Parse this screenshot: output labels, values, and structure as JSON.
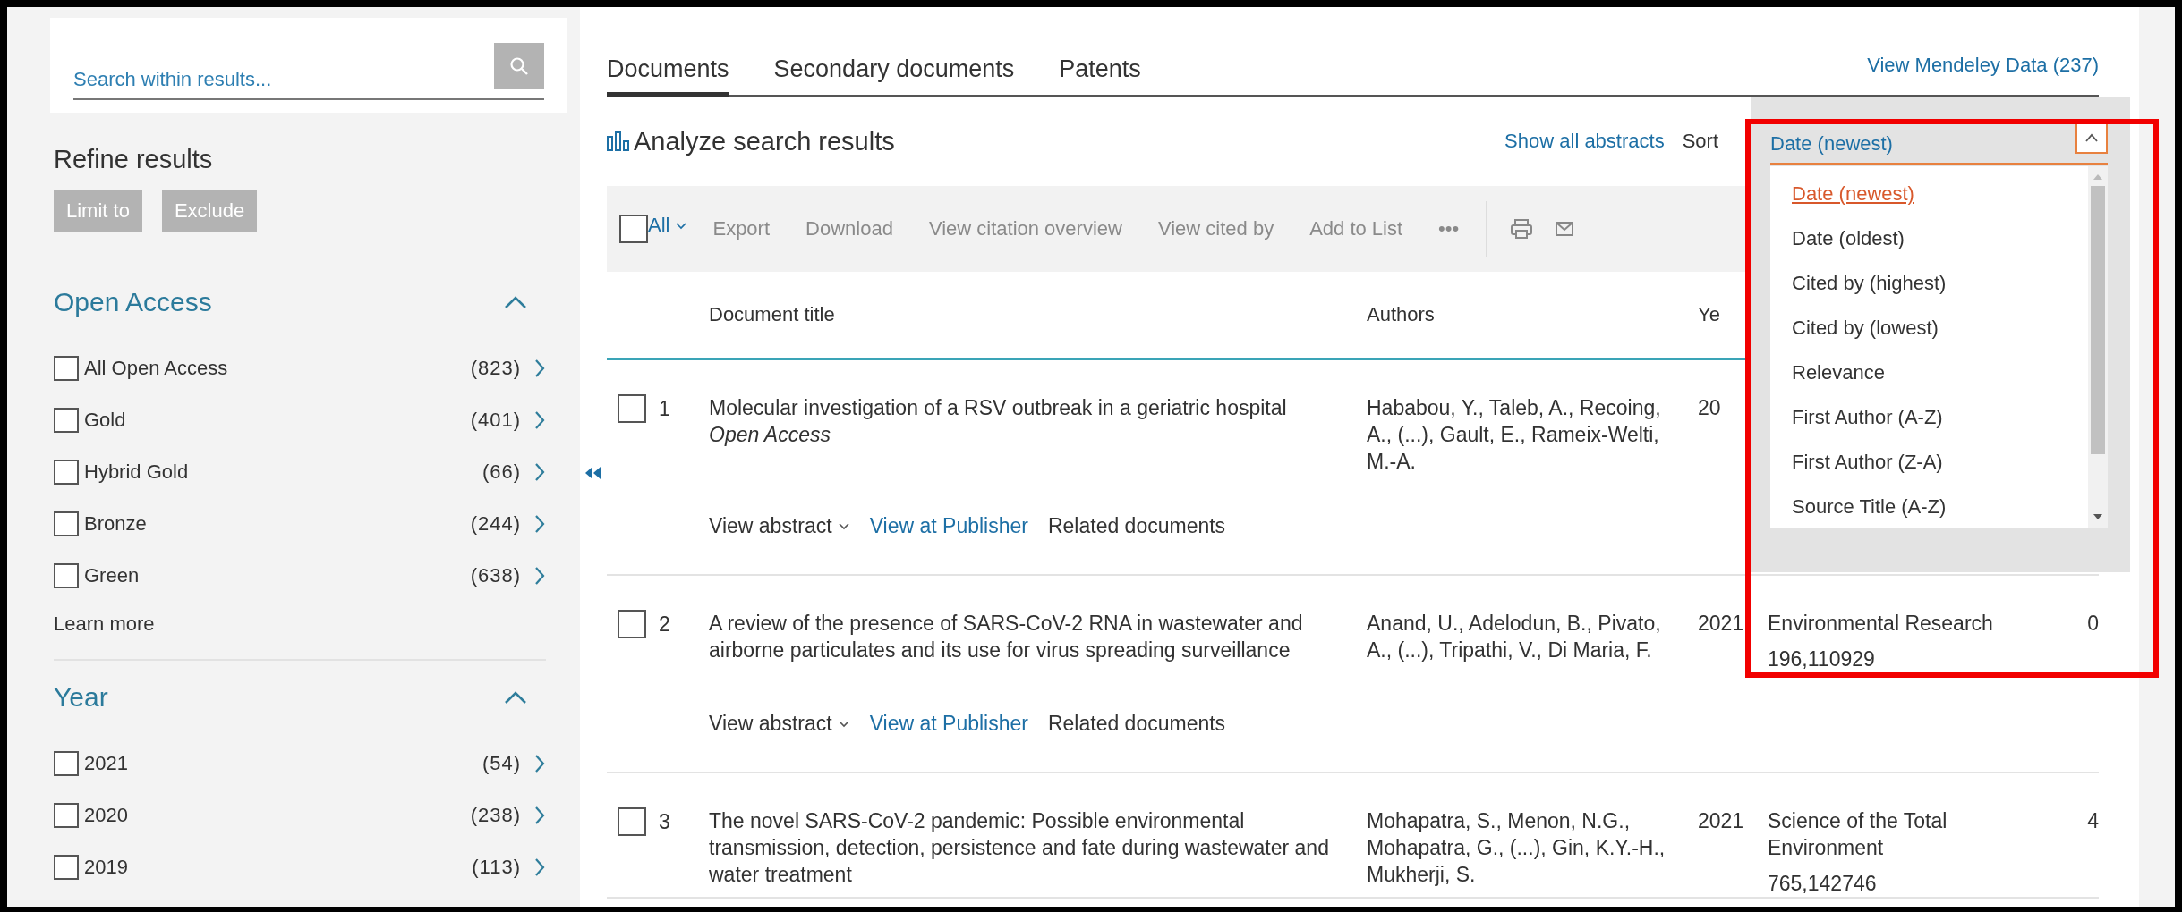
{
  "sidebar": {
    "search": {
      "placeholder": "Search within results..."
    },
    "title": "Refine results",
    "buttons": [
      "Limit to",
      "Exclude"
    ],
    "facets": [
      {
        "title": "Open Access",
        "expanded": true,
        "items": [
          {
            "label": "All Open Access",
            "count": "(823)",
            "checked": false
          },
          {
            "label": "Gold",
            "count": "(401)",
            "checked": false
          },
          {
            "label": "Hybrid Gold",
            "count": "(66)",
            "checked": false
          },
          {
            "label": "Bronze",
            "count": "(244)",
            "checked": false
          },
          {
            "label": "Green",
            "count": "(638)",
            "checked": false
          }
        ],
        "footer_link": "Learn more"
      },
      {
        "title": "Year",
        "expanded": true,
        "items": [
          {
            "label": "2021",
            "count": "(54)",
            "checked": false
          },
          {
            "label": "2020",
            "count": "(238)",
            "checked": false
          },
          {
            "label": "2019",
            "count": "(113)",
            "checked": false
          }
        ]
      }
    ]
  },
  "tabs": [
    {
      "label": "Documents",
      "selected": true
    },
    {
      "label": "Secondary documents",
      "selected": false
    },
    {
      "label": "Patents",
      "selected": false
    }
  ],
  "mendeley_link": "View Mendeley Data (237)",
  "analyze": "Analyze search results",
  "show_abstracts": "Show all abstracts",
  "sort_label": "Sort",
  "toolbar": {
    "select_all": {
      "label": "All",
      "checked": false
    },
    "actions": [
      "Export",
      "Download",
      "View citation overview",
      "View cited by",
      "Add to List",
      "•••"
    ]
  },
  "table": {
    "columns": [
      "Document title",
      "Authors",
      "Ye"
    ],
    "rows": [
      {
        "checked": false,
        "number": "1",
        "title": "Molecular investigation of a RSV outbreak in a geriatric hospital",
        "access": "Open Access",
        "authors": "Hababou, Y., Taleb, A., Recoing, A., (...), Gault, E., Rameix-Welti, M.-A.",
        "year": "20",
        "actions": [
          {
            "kind": "toggle",
            "label": "View abstract"
          },
          {
            "kind": "link",
            "label": "View at Publisher"
          },
          {
            "kind": "plain",
            "label": "Related documents"
          }
        ]
      },
      {
        "checked": false,
        "number": "2",
        "title": "A review of the presence of SARS-CoV-2 RNA in wastewater and airborne particulates and its use for virus spreading surveillance",
        "authors": "Anand, U., Adelodun, B., Pivato, A., (...), Tripathi, V., Di Maria, F.",
        "year": "2021",
        "source": "Environmental Research",
        "volume": "196,110929",
        "cited": "0",
        "actions": [
          {
            "kind": "toggle",
            "label": "View abstract"
          },
          {
            "kind": "link",
            "label": "View at Publisher"
          },
          {
            "kind": "plain",
            "label": "Related documents"
          }
        ]
      },
      {
        "checked": false,
        "number": "3",
        "title": "The novel SARS-CoV-2 pandemic: Possible environmental transmission, detection, persistence and fate during wastewater and water treatment",
        "authors": "Mohapatra, S., Menon, N.G., Mohapatra, G., (...), Gin, K.Y.-H., Mukherji, S.",
        "year": "2021",
        "source": "Science of the Total Environment",
        "volume": "765,142746",
        "cited": "4",
        "actions": []
      }
    ]
  },
  "sort_dropdown": {
    "value": "Date (newest)",
    "expanded": true,
    "options": [
      {
        "label": "Date (newest)",
        "selected": true
      },
      {
        "label": "Date (oldest)",
        "selected": false
      },
      {
        "label": "Cited by (highest)",
        "selected": false
      },
      {
        "label": "Cited by (lowest)",
        "selected": false
      },
      {
        "label": "Relevance",
        "selected": false
      },
      {
        "label": "First Author (A-Z)",
        "selected": false
      },
      {
        "label": "First Author (Z-A)",
        "selected": false
      },
      {
        "label": "Source Title (A-Z)",
        "selected": false
      }
    ]
  }
}
